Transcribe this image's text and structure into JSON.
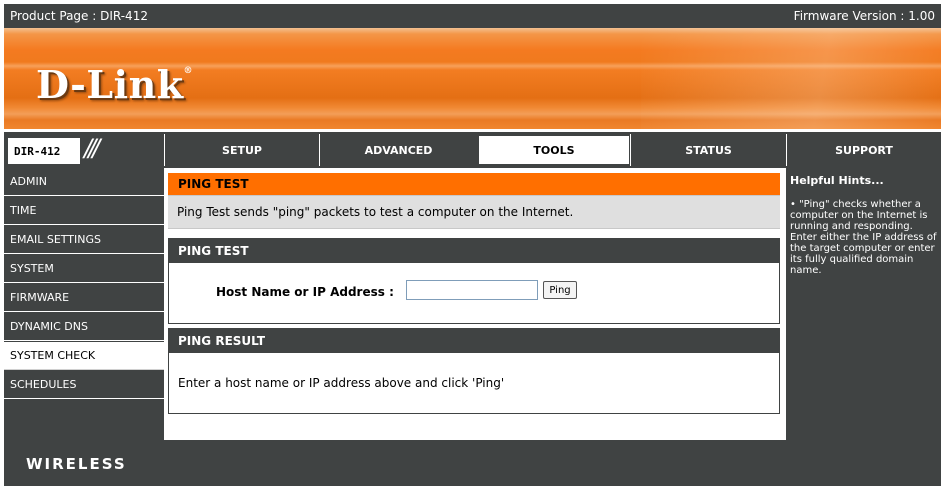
{
  "header": {
    "product_page": "Product Page : DIR-412",
    "firmware": "Firmware Version : 1.00"
  },
  "banner": {
    "logo": "D-Link",
    "logo_mark": "®"
  },
  "nav": {
    "model": "DIR-412",
    "model_slashes": "///",
    "tabs": [
      {
        "label": "SETUP"
      },
      {
        "label": "ADVANCED"
      },
      {
        "label": "TOOLS",
        "active": true
      },
      {
        "label": "STATUS"
      },
      {
        "label": "SUPPORT"
      }
    ]
  },
  "sidebar": {
    "items": [
      {
        "label": "ADMIN"
      },
      {
        "label": "TIME"
      },
      {
        "label": "EMAIL SETTINGS"
      },
      {
        "label": "SYSTEM"
      },
      {
        "label": "FIRMWARE"
      },
      {
        "label": "DYNAMIC DNS"
      },
      {
        "label": "SYSTEM CHECK",
        "active": true
      },
      {
        "label": "SCHEDULES"
      }
    ]
  },
  "main": {
    "intro": {
      "title": "PING TEST",
      "description": "Ping Test sends \"ping\" packets to test a computer on the Internet."
    },
    "ping_test": {
      "title": "PING TEST",
      "host_label": "Host Name or IP Address :",
      "host_value": "",
      "ping_button": "Ping"
    },
    "ping_result": {
      "title": "PING RESULT",
      "message": "Enter a host name or IP address above and click 'Ping'"
    }
  },
  "hints": {
    "title": "Helpful Hints...",
    "text": "• \"Ping\" checks whether a computer on the Internet is running and responding. Enter either the IP address of the target computer or enter its fully qualified domain name."
  },
  "footer": {
    "brand": "WIRELESS"
  },
  "colors": {
    "dark": "#404343",
    "orange": "#ff6f00",
    "banner_orange": "#f47a20"
  }
}
